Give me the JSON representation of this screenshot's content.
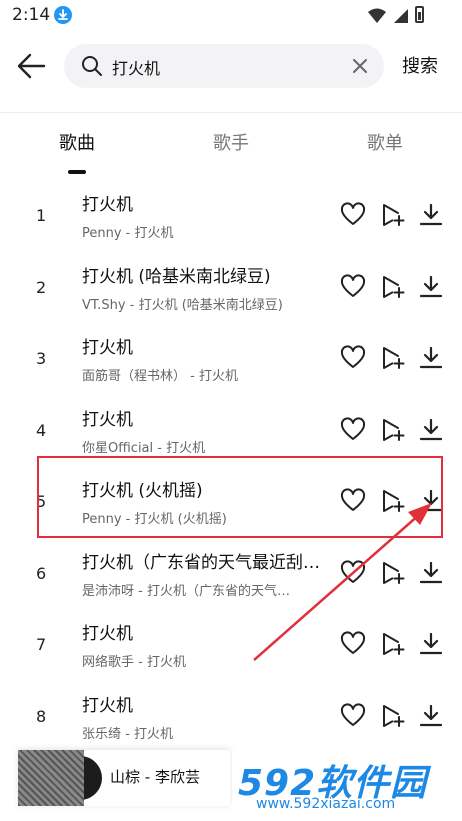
{
  "status": {
    "time": "2:14"
  },
  "search": {
    "value": "打火机",
    "submit_label": "搜索"
  },
  "tabs": [
    {
      "label": "歌曲",
      "active": true
    },
    {
      "label": "歌手",
      "active": false
    },
    {
      "label": "歌单",
      "active": false
    }
  ],
  "songs": [
    {
      "num": "1",
      "title": "打火机",
      "subtitle": "Penny - 打火机"
    },
    {
      "num": "2",
      "title": "打火机 (哈基米南北绿豆)",
      "subtitle": "VT.Shy - 打火机 (哈基米南北绿豆)"
    },
    {
      "num": "3",
      "title": "打火机",
      "subtitle": "面筋哥（程书林） - 打火机"
    },
    {
      "num": "4",
      "title": "打火机",
      "subtitle": "你星Official - 打火机"
    },
    {
      "num": "5",
      "title": "打火机 (火机摇)",
      "subtitle": "Penny - 打火机 (火机摇)"
    },
    {
      "num": "6",
      "title": "打火机（广东省的天气最近刮…",
      "subtitle": "是沛沛呀 - 打火机（广东省的天气…"
    },
    {
      "num": "7",
      "title": "打火机",
      "subtitle": "网络歌手 - 打火机"
    },
    {
      "num": "8",
      "title": "打火机",
      "subtitle": "张乐绮 - 打火机"
    }
  ],
  "player": {
    "now_playing": "山棕 - 李欣芸"
  },
  "watermark": {
    "brand": "592软件园",
    "url": "www.592xiazai.com"
  },
  "colors": {
    "highlight": "#e0303a",
    "brand": "#1e88e5",
    "download_badge": "#2196f3"
  }
}
